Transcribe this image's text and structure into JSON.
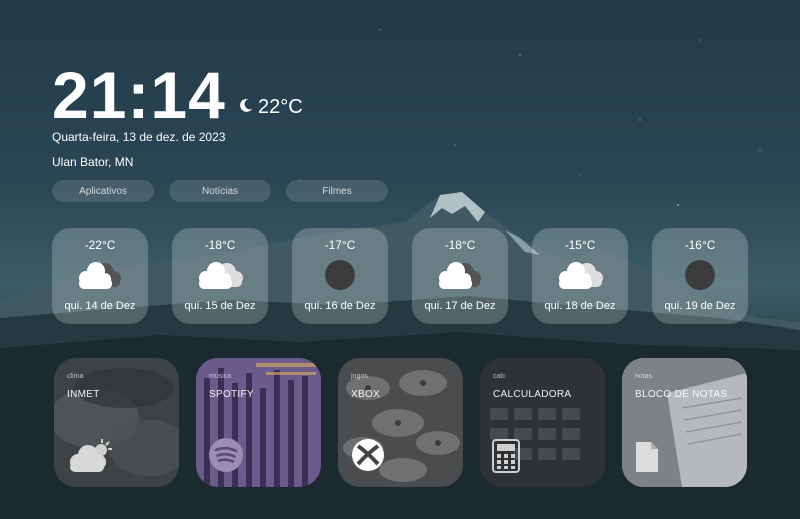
{
  "clock": {
    "time": "21:14",
    "temperature": "22°C",
    "condition_icon": "moon-icon"
  },
  "date": "Quarta-feira, 13 de dez. de 2023",
  "location": "Ulan Bator, MN",
  "tabs": [
    {
      "label": "Aplicativos"
    },
    {
      "label": "Notícias"
    },
    {
      "label": "Filmes"
    }
  ],
  "forecast": [
    {
      "temp": "-22°C",
      "day": "qui. 14 de Dez",
      "icon": "cloud-dark-icon"
    },
    {
      "temp": "-18°C",
      "day": "qui. 15 de Dez",
      "icon": "cloud-light-icon"
    },
    {
      "temp": "-17°C",
      "day": "qui. 16 de Dez",
      "icon": "dark-circle-icon"
    },
    {
      "temp": "-18°C",
      "day": "qui. 17 de Dez",
      "icon": "cloud-dark-icon"
    },
    {
      "temp": "-15°C",
      "day": "qui. 18 de Dez",
      "icon": "cloud-light-icon"
    },
    {
      "temp": "-16°C",
      "day": "qui. 19 de Dez",
      "icon": "dark-circle-icon"
    }
  ],
  "apps": [
    {
      "category": "clima",
      "name": "INMET",
      "icon": "partly-cloudy-icon"
    },
    {
      "category": "música",
      "name": "SPOTIFY",
      "icon": "spotify-icon"
    },
    {
      "category": "jogos",
      "name": "XBOX",
      "icon": "xbox-icon"
    },
    {
      "category": "calc",
      "name": "CALCULADORA",
      "icon": "calculator-icon"
    },
    {
      "category": "notas",
      "name": "BLOCO DE NOTAS",
      "icon": "document-icon"
    }
  ]
}
